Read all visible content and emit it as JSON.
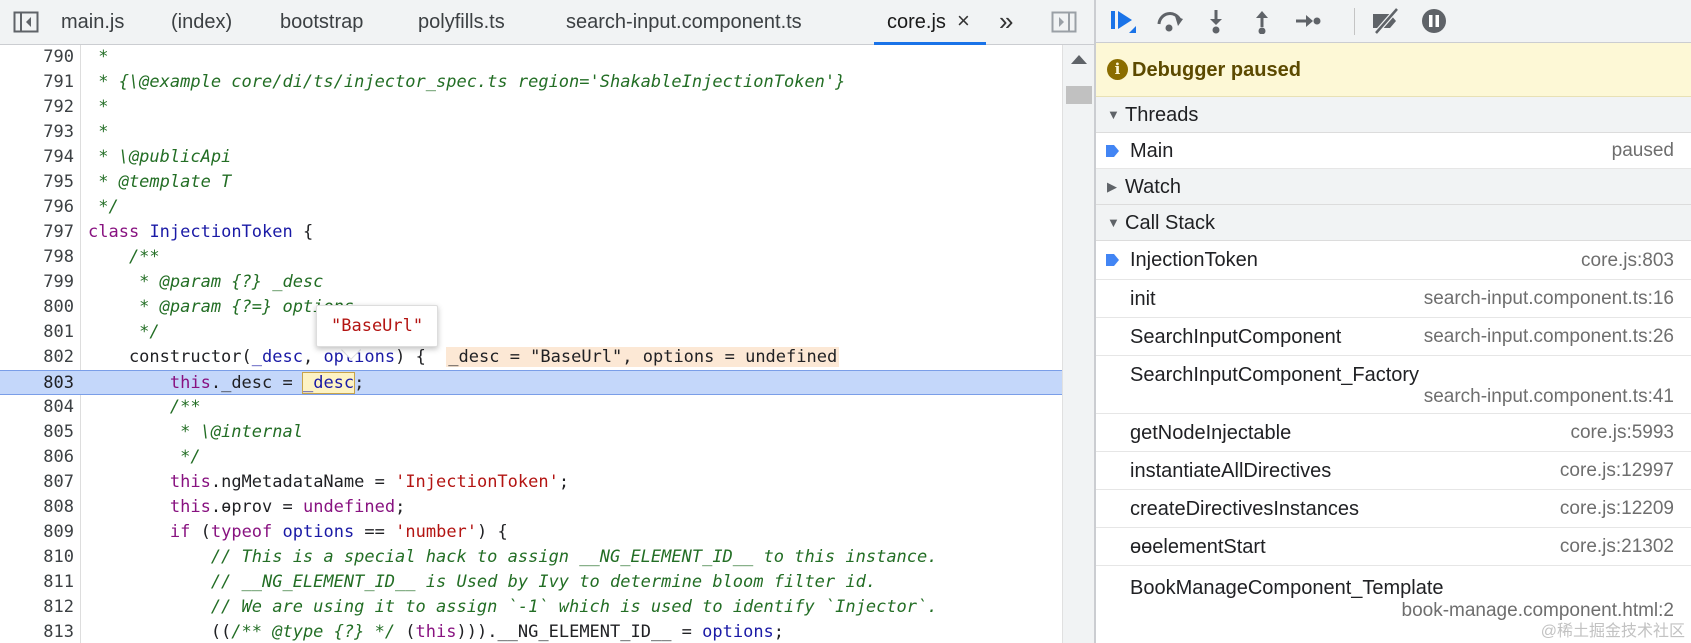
{
  "tabs": {
    "items": [
      {
        "label": "main.js"
      },
      {
        "label": "(index)"
      },
      {
        "label": "bootstrap"
      },
      {
        "label": "polyfills.ts"
      },
      {
        "label": "search-input.component.ts"
      },
      {
        "label": "core.js",
        "active": true
      }
    ],
    "close_glyph": "×",
    "more_glyph": "»",
    "icons": {
      "toggle_navigator": "sidebar-toggle-icon",
      "toggle_debugger": "debugger-panel-toggle-icon"
    }
  },
  "code": {
    "paused_line": 803,
    "hover_tooltip": "\"BaseUrl\"",
    "inline_values": "_desc = \"BaseUrl\", options = undefined",
    "lines": [
      {
        "n": "790"
      },
      {
        "n": "791"
      },
      {
        "n": "792"
      },
      {
        "n": "793"
      },
      {
        "n": "794"
      },
      {
        "n": "795"
      },
      {
        "n": "796"
      },
      {
        "n": "797"
      },
      {
        "n": "798"
      },
      {
        "n": "799"
      },
      {
        "n": "800"
      },
      {
        "n": "801"
      },
      {
        "n": "802"
      },
      {
        "n": "803"
      },
      {
        "n": "804"
      },
      {
        "n": "805"
      },
      {
        "n": "806"
      },
      {
        "n": "807"
      },
      {
        "n": "808"
      },
      {
        "n": "809"
      },
      {
        "n": "810"
      },
      {
        "n": "811"
      },
      {
        "n": "812"
      },
      {
        "n": "813"
      }
    ],
    "text": {
      "l790": " *",
      "l791": " * {\\@example core/di/ts/injector_spec.ts region='ShakableInjectionToken'}",
      "l792": " *",
      "l793": " *",
      "l794": " * \\@publicApi",
      "l795": " * @template T",
      "l796": " */",
      "l797_kw": "class",
      "l797_name": "InjectionToken",
      "l797_rest": " {",
      "l798": "    /**",
      "l799": "     * @param {?} _desc",
      "l800": "     * @param {?=} options",
      "l801": "     */",
      "l802_a": "    constructor(",
      "l802_p1": "_desc",
      "l802_b": ", ",
      "l802_p2": "options",
      "l802_c": ") {  ",
      "l803_a": "        ",
      "l803_this": "this",
      "l803_b": "._desc = ",
      "l803_eval": "_desc",
      "l803_c": ";",
      "l804": "        /**",
      "l805": "         * \\@internal",
      "l806": "         */",
      "l807_a": "        ",
      "l807_this": "this",
      "l807_b": ".ngMetadataName = ",
      "l807_str": "'InjectionToken'",
      "l807_c": ";",
      "l808_a": "        ",
      "l808_this": "this",
      "l808_b": ".ɵprov = ",
      "l808_undef": "undefined",
      "l808_c": ";",
      "l809_a": "        ",
      "l809_if": "if",
      "l809_b": " (",
      "l809_typeof": "typeof",
      "l809_sp": " ",
      "l809_opts": "options",
      "l809_c": " == ",
      "l809_str": "'number'",
      "l809_d": ") {",
      "l810": "            // This is a special hack to assign __NG_ELEMENT_ID__ to this instance.",
      "l811": "            // __NG_ELEMENT_ID__ is Used by Ivy to determine bloom filter id.",
      "l812": "            // We are using it to assign `-1` which is used to identify `Injector`.",
      "l813_a": "            ((",
      "l813_com": "/** @type {?} */",
      "l813_b": " (",
      "l813_this": "this",
      "l813_c": "))).__NG_ELEMENT_ID__ = ",
      "l813_opts": "options",
      "l813_d": ";"
    }
  },
  "debugger": {
    "toolbar_icons": [
      "resume-icon",
      "step-over-icon",
      "step-into-icon",
      "step-out-icon",
      "step-icon",
      "deactivate-breakpoints-icon",
      "pause-on-exceptions-icon"
    ],
    "paused_message": "Debugger paused",
    "threads": {
      "title": "Threads",
      "items": [
        {
          "name": "Main",
          "status": "paused"
        }
      ]
    },
    "watch": {
      "title": "Watch"
    },
    "call_stack": {
      "title": "Call Stack",
      "frames": [
        {
          "name": "InjectionToken",
          "location": "core.js:803"
        },
        {
          "name": "init",
          "location": "search-input.component.ts:16"
        },
        {
          "name": "SearchInputComponent",
          "location": "search-input.component.ts:26"
        },
        {
          "name": "SearchInputComponent_Factory",
          "location": "search-input.component.ts:41"
        },
        {
          "name": "getNodeInjectable",
          "location": "core.js:5993"
        },
        {
          "name": "instantiateAllDirectives",
          "location": "core.js:12997"
        },
        {
          "name": "createDirectivesInstances",
          "location": "core.js:12209"
        },
        {
          "name": "ɵɵelementStart",
          "location": "core.js:21302"
        },
        {
          "name": "BookManageComponent_Template",
          "location": "book-manage.component.html:2"
        }
      ]
    },
    "accent_color": "#4285f4"
  },
  "watermark": "@稀土掘金技术社区"
}
